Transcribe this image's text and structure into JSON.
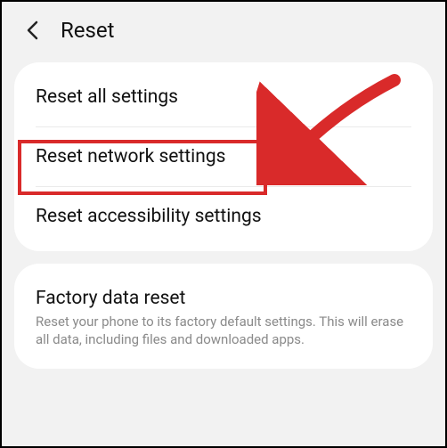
{
  "header": {
    "title": "Reset"
  },
  "section1": {
    "items": [
      {
        "title": "Reset all settings"
      },
      {
        "title": "Reset network settings"
      },
      {
        "title": "Reset accessibility settings"
      }
    ]
  },
  "section2": {
    "items": [
      {
        "title": "Factory data reset",
        "sub": "Reset your phone to its factory default settings. This will erase all data, including files and downloaded apps."
      }
    ]
  },
  "annotation": {
    "highlight_color": "#d92a2a"
  }
}
